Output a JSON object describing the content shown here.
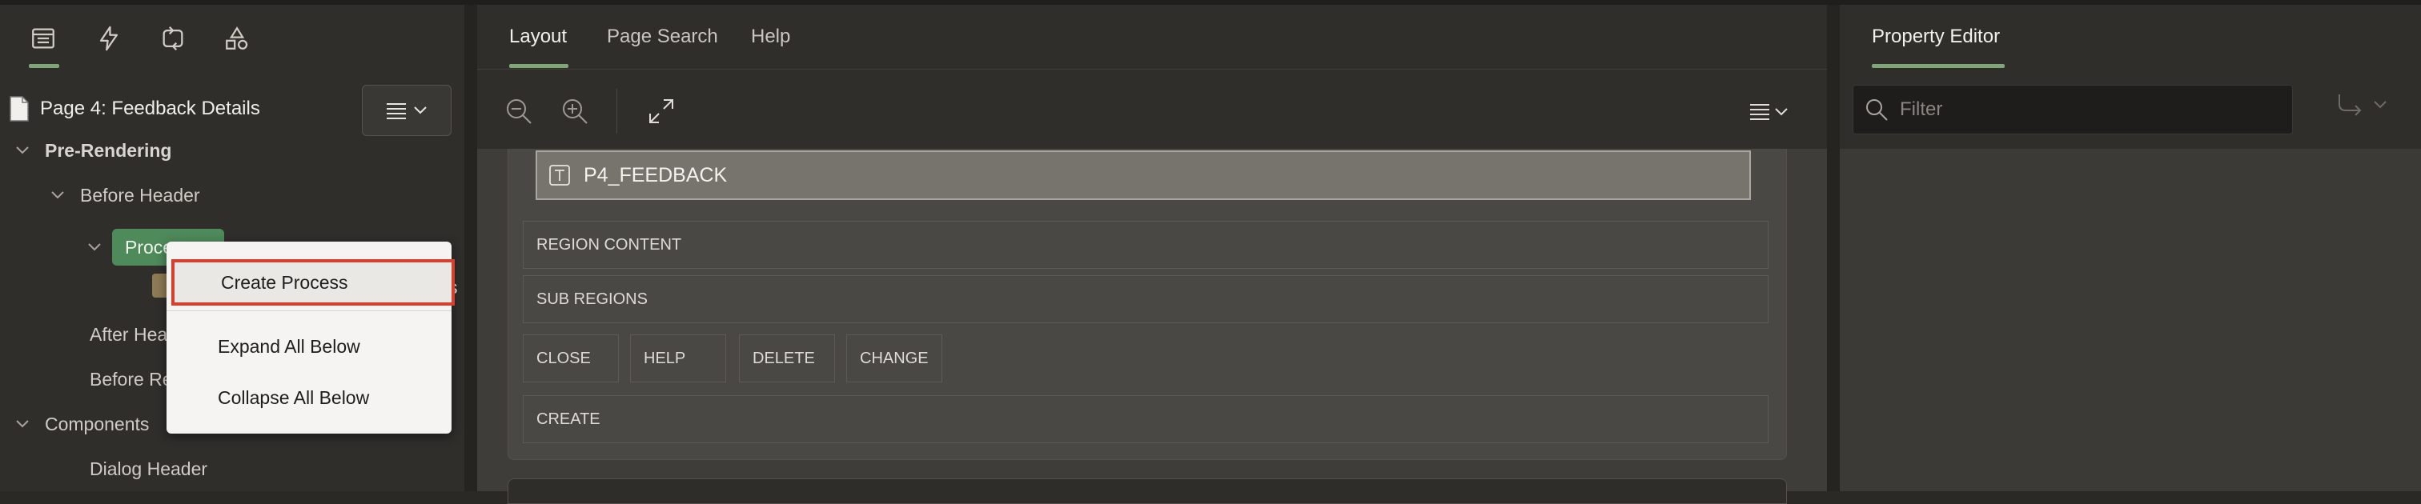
{
  "left_panel": {
    "tab_icons": [
      "rendering-icon",
      "dynamic-actions-icon",
      "processing-icon",
      "shared-components-icon"
    ],
    "page_title": "Page 4: Feedback Details",
    "tree": {
      "pre_rendering": "Pre-Rendering",
      "before_header": "Before Header",
      "processes": "Processes",
      "after_header": "After Header",
      "before_regions": "Before Regions",
      "components": "Components",
      "dialog_header": "Dialog Header",
      "trailing_text": "s"
    }
  },
  "context_menu": {
    "items": [
      "Create Process",
      "Expand All Below",
      "Collapse All Below"
    ],
    "selected": "Create Process"
  },
  "center_panel": {
    "tabs": [
      "Layout",
      "Page Search",
      "Help"
    ],
    "active_tab": "Layout",
    "page_item": "P4_FEEDBACK",
    "positions": {
      "region_content": "REGION CONTENT",
      "sub_regions": "SUB REGIONS",
      "buttons": [
        "CLOSE",
        "HELP",
        "DELETE",
        "CHANGE"
      ],
      "create": "CREATE"
    }
  },
  "right_panel": {
    "title": "Property Editor",
    "filter_placeholder": "Filter"
  },
  "colors": {
    "accent": "#7fa679",
    "selected_pill": "#4e8a5a",
    "highlight_border": "#d6402c"
  }
}
